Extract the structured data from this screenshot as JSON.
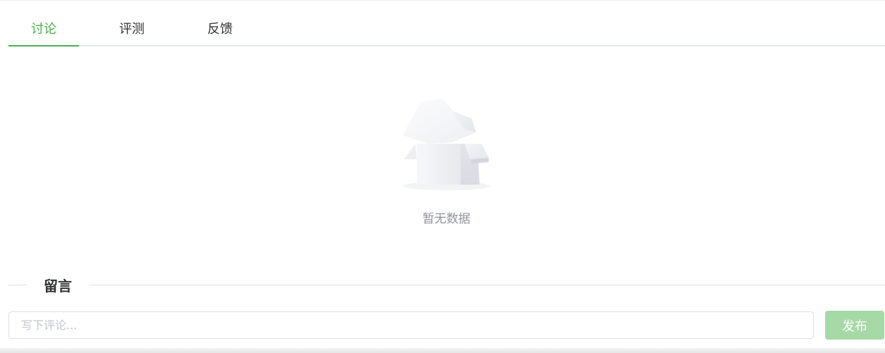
{
  "tabs": [
    {
      "label": "讨论",
      "active": true
    },
    {
      "label": "评测",
      "active": false
    },
    {
      "label": "反馈",
      "active": false
    }
  ],
  "empty_state": {
    "icon": "empty-box-icon",
    "text": "暂无数据"
  },
  "comment_section": {
    "title": "留言",
    "input_value": "",
    "input_placeholder": "写下评论...",
    "submit_label": "发布"
  },
  "colors": {
    "accent": "#4cae4c",
    "button_disabled": "#a6d9a6",
    "muted_text": "#909399"
  }
}
